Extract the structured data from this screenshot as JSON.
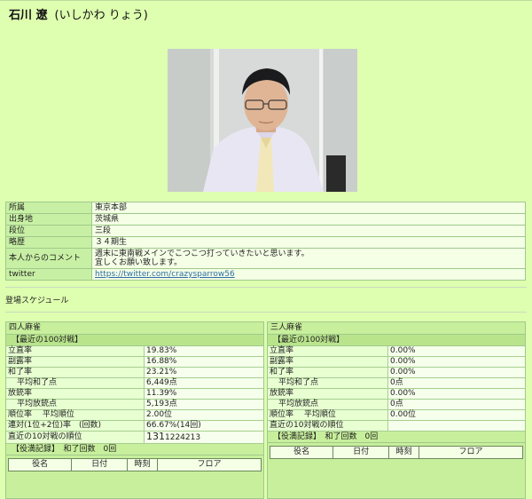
{
  "header": {
    "name": "石川 遼",
    "reading": "(いしかわ りょう)"
  },
  "profile": [
    {
      "key": "所属",
      "value": "東京本部"
    },
    {
      "key": "出身地",
      "value": "茨城県"
    },
    {
      "key": "段位",
      "value": "三段"
    },
    {
      "key": "略歴",
      "value": "３４期生"
    },
    {
      "key": "本人からのコメント",
      "line1": "週末に東南戦メインでこつこつ打っていきたいと思います。",
      "line2": "宜しくお願い致します。"
    },
    {
      "key": "twitter",
      "value": "https://twitter.com/crazysparrow56"
    }
  ],
  "schedule_label": "登場スケジュール",
  "yonma": {
    "title": "四人麻雀",
    "recent_label": "【最近の100対戦】",
    "stats": [
      {
        "key": "立直率",
        "value": "19.83%"
      },
      {
        "key": "副露率",
        "value": "16.88%"
      },
      {
        "key": "和了率",
        "value": "23.21%"
      },
      {
        "key": "平均和了点",
        "value": "6,449点"
      },
      {
        "key": "放銃率",
        "value": "11.39%"
      },
      {
        "key": "平均放銃点",
        "value": "5,193点"
      },
      {
        "key": "順位率　 平均順位",
        "value": "2.00位"
      },
      {
        "key": "連対(1位+2位)率　(回数)",
        "value": "66.67%(14回)"
      },
      {
        "key": "直近の10対戦の順位",
        "value_big": "131",
        "value_small": "1224213"
      }
    ],
    "records_label": "【役満記録】　和了回数　0回",
    "columns": [
      "役名",
      "日付",
      "時刻",
      "フロア"
    ]
  },
  "sanma": {
    "title": "三人麻雀",
    "recent_label": "【最近の100対戦】",
    "stats": [
      {
        "key": "立直率",
        "value": "0.00%"
      },
      {
        "key": "副露率",
        "value": "0.00%"
      },
      {
        "key": "和了率",
        "value": "0.00%"
      },
      {
        "key": "平均和了点",
        "value": "0点"
      },
      {
        "key": "放銃率",
        "value": "0.00%"
      },
      {
        "key": "平均放銃点",
        "value": "0点"
      },
      {
        "key": "順位率　 平均順位",
        "value": "0.00位"
      },
      {
        "key": "直近の10対戦の順位",
        "value": ""
      }
    ],
    "records_label": "【役満記録】　和了回数　0回",
    "columns": [
      "役名",
      "日付",
      "時刻",
      "フロア"
    ]
  }
}
